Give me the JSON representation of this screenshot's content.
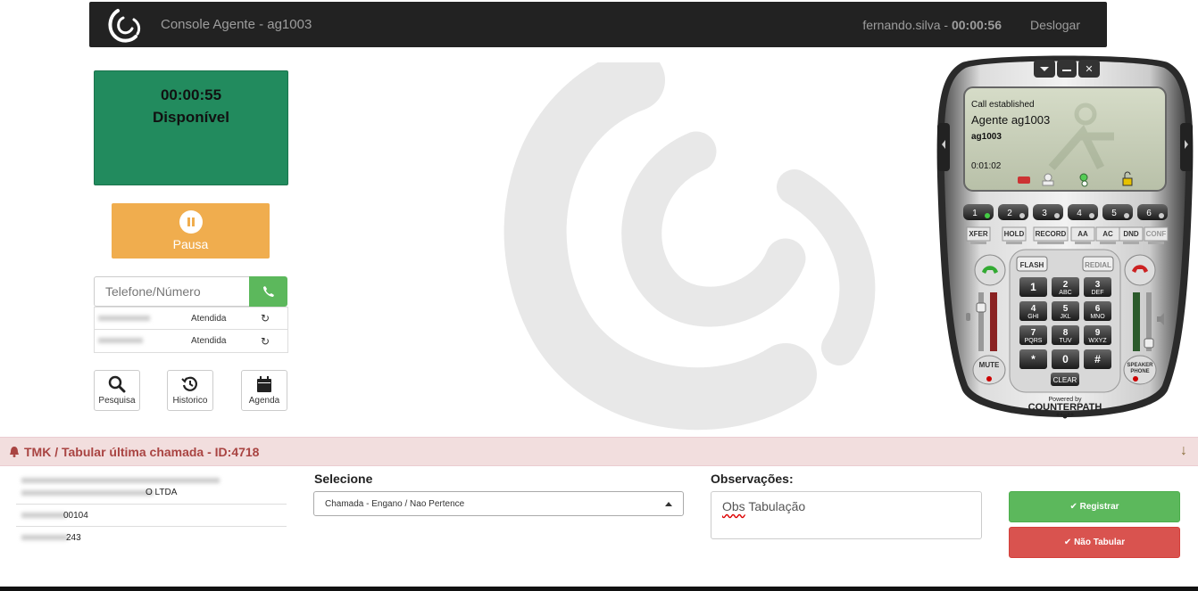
{
  "nav": {
    "title": "Console Agente - ag1003",
    "user": "fernando.silva - ",
    "session_time": "00:00:56",
    "logout": "Deslogar"
  },
  "status": {
    "timer": "00:00:55",
    "state": "Disponível"
  },
  "pause": {
    "label": "Pausa"
  },
  "dial": {
    "placeholder": "Telefone/Número"
  },
  "recent_calls": [
    {
      "status": "Atendida"
    },
    {
      "status": "Atendida"
    }
  ],
  "tools": [
    {
      "label": "Pesquisa",
      "icon": "search-icon"
    },
    {
      "label": "Historico",
      "icon": "history-icon"
    },
    {
      "label": "Agenda",
      "icon": "calendar-icon"
    }
  ],
  "softphone": {
    "status": "Call established",
    "caller": "Agente ag1003",
    "caller_id": "ag1003",
    "duration": "0:01:02",
    "lines": [
      "1",
      "2",
      "3",
      "4",
      "5",
      "6"
    ],
    "func_keys": [
      "XFER",
      "HOLD",
      "RECORD",
      "AA",
      "AC",
      "DND",
      "CONF"
    ],
    "flash": "FLASH",
    "redial": "REDIAL",
    "keys": [
      {
        "d": "1",
        "s": ""
      },
      {
        "d": "2",
        "s": "ABC"
      },
      {
        "d": "3",
        "s": "DEF"
      },
      {
        "d": "4",
        "s": "GHI"
      },
      {
        "d": "5",
        "s": "JKL"
      },
      {
        "d": "6",
        "s": "MNO"
      },
      {
        "d": "7",
        "s": "PQRS"
      },
      {
        "d": "8",
        "s": "TUV"
      },
      {
        "d": "9",
        "s": "WXYZ"
      },
      {
        "d": "*",
        "s": ""
      },
      {
        "d": "0",
        "s": ""
      },
      {
        "d": "#",
        "s": ""
      }
    ],
    "clear": "CLEAR",
    "mute": "MUTE",
    "speaker": "SPEAKER PHONE",
    "powered": "Powered by",
    "brand": "COUNTERPATH"
  },
  "panel": {
    "title": "TMK / Tabular última chamada - ID:4718",
    "company_suffix": "O LTDA",
    "code_suffix": "00104",
    "num_suffix": "243",
    "select_label": "Selecione",
    "select_value": "Chamada - Engano / Nao Pertence",
    "obs_label": "Observações:",
    "obs_word1": "Obs",
    "obs_word2": " Tabulação",
    "register": "Registrar",
    "no_tab": "Não Tabular"
  }
}
